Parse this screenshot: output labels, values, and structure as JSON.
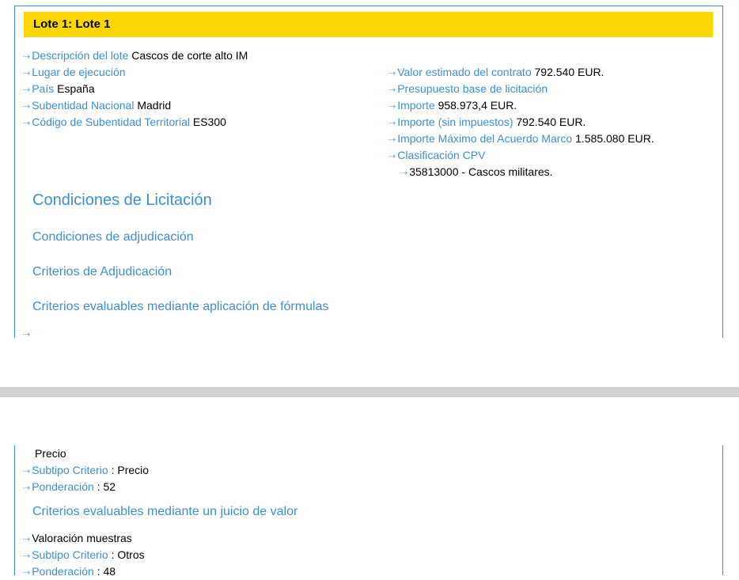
{
  "lote_title": "Lote 1: Lote 1",
  "arrow": "⇢",
  "left_fields": [
    {
      "label": "Descripción del lote",
      "value": "Cascos de corte alto IM"
    },
    {
      "label": "Lugar de ejecución",
      "value": ""
    },
    {
      "label": "País",
      "value": "España"
    },
    {
      "label": "Subentidad Nacional",
      "value": "Madrid"
    },
    {
      "label": "Código de Subentidad Territorial",
      "value": "ES300"
    }
  ],
  "right_fields": [
    {
      "label": "Valor estimado del contrato",
      "value": "792.540 EUR."
    },
    {
      "label": "Presupuesto base de licitación",
      "value": ""
    },
    {
      "label": "Importe",
      "value": "958.973,4 EUR."
    },
    {
      "label": "Importe (sin impuestos)",
      "value": "792.540 EUR."
    },
    {
      "label": "Importe Máximo del Acuerdo Marco",
      "value": "1.585.080 EUR."
    },
    {
      "label": "Clasificación CPV",
      "value": ""
    }
  ],
  "cpv_item": "35813000 - Cascos militares.",
  "headings": {
    "condiciones_licitacion": "Condiciones de Licitación",
    "condiciones_adjudicacion": "Condiciones de adjudicación",
    "criterios_adjudicacion": "Criterios de Adjudicación",
    "criterios_formulas": "Criterios evaluables mediante aplicación de fórmulas",
    "criterios_juicio": "Criterios evaluables mediante un juicio de valor"
  },
  "criterio_formula": {
    "name": "Precio",
    "subtipo_label": "Subtipo Criterio",
    "subtipo_value": ": Precio",
    "ponderacion_label": "Ponderación",
    "ponderacion_value": ": 52"
  },
  "criterio_juicio": {
    "name": "Valoración muestras",
    "subtipo_label": "Subtipo Criterio",
    "subtipo_value": ": Otros",
    "ponderacion_label": "Ponderación",
    "ponderacion_value": ": 48"
  }
}
